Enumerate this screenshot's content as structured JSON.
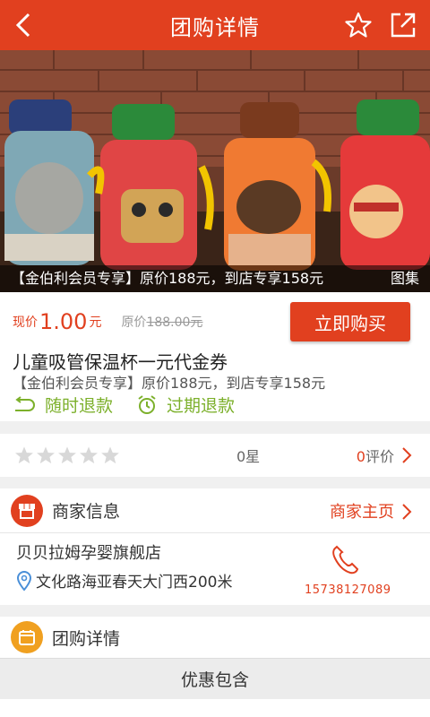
{
  "header": {
    "title": "团购详情"
  },
  "hero": {
    "caption": "【金伯利会员专享】原价188元，到店专享158元",
    "gallery_label": "图集"
  },
  "price": {
    "now_label": "现价",
    "now_value": "1.00",
    "now_unit": "元",
    "orig_label": "原价",
    "orig_value": "188.00元",
    "buy_label": "立即购买"
  },
  "product": {
    "title": "儿童吸管保温杯一元代金券",
    "subtitle": "【金伯利会员专享】原价188元，到店专享158元"
  },
  "refund": {
    "anytime": "随时退款",
    "expired": "过期退款"
  },
  "rating": {
    "stars_filled": 0,
    "stars_total": 5,
    "star_text": "0星",
    "review_num": "0",
    "review_label": "评价"
  },
  "merchant": {
    "section_title": "商家信息",
    "home_link": "商家主页",
    "shop_name": "贝贝拉姆孕婴旗舰店",
    "address": "文化路海亚春天大门西200米",
    "phone": "15738127089"
  },
  "group": {
    "section_title": "团购详情",
    "offer_title": "优惠包含"
  },
  "colors": {
    "accent": "#e1401f",
    "green": "#7cb02b",
    "orange_icon": "#f0a020"
  }
}
